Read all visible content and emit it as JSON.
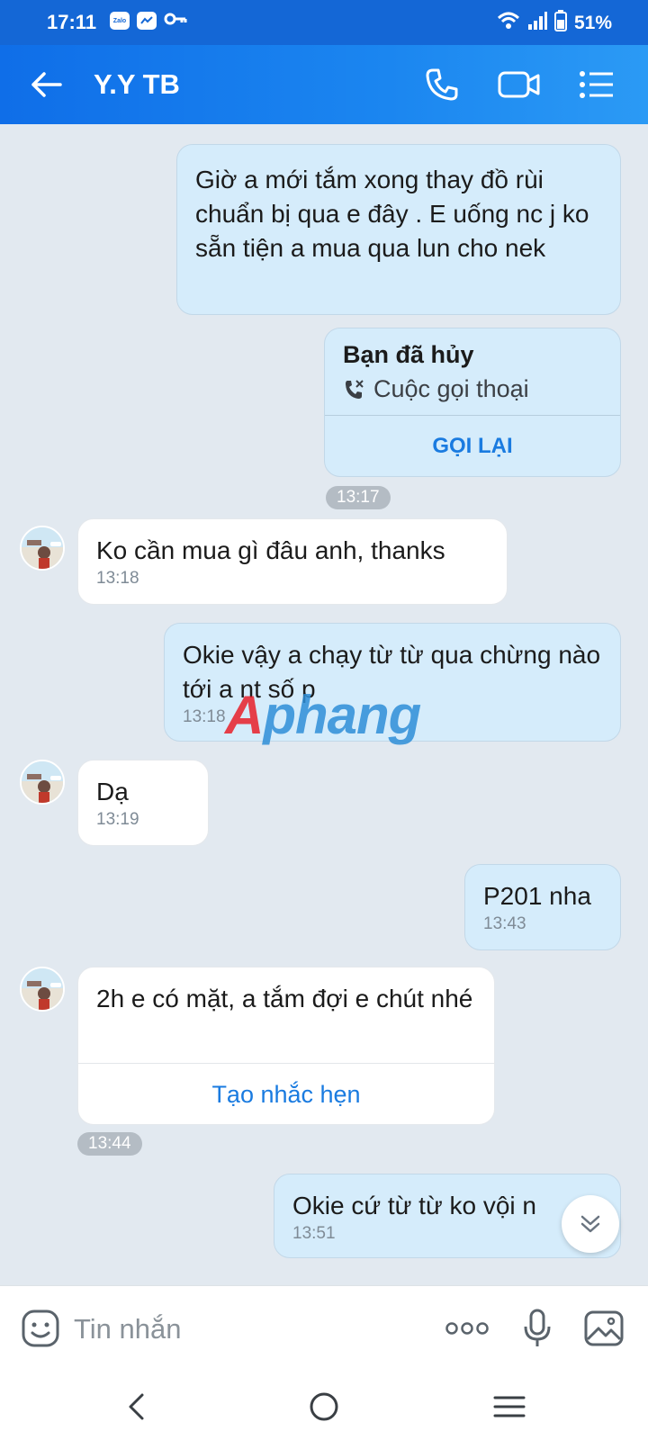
{
  "status": {
    "time": "17:11",
    "app_icon_label": "Zalo",
    "battery": "51%"
  },
  "header": {
    "title": "Y.Y TB"
  },
  "messages": [
    {
      "text": "Giờ a mới tắm xong thay đồ rùi chuẩn bị qua e đây . E uống nc j ko sẵn tiện a mua qua lun cho nek"
    },
    {
      "call_title": "Bạn đã hủy",
      "call_subtitle": "Cuộc gọi thoại",
      "call_action": "GỌI LẠI",
      "time": "13:17"
    },
    {
      "text": "Ko cần mua gì đâu anh, thanks",
      "time": "13:18"
    },
    {
      "text": "Okie vậy a chạy từ từ qua chừng nào tới a nt số p",
      "time": "13:18"
    },
    {
      "text": "Dạ",
      "time": "13:19"
    },
    {
      "text": "P201 nha",
      "time": "13:43"
    },
    {
      "text": "2h e có mặt, a tắm đợi e chút nhé",
      "action": "Tạo nhắc hẹn",
      "time": "13:44"
    },
    {
      "text": "Okie cứ từ từ ko vội n",
      "time": "13:51"
    }
  ],
  "watermark": {
    "first": "A",
    "rest": "phang"
  },
  "input": {
    "placeholder": "Tin nhắn"
  },
  "colors": {
    "header": "#1b86f0",
    "sent_bubble": "#d5ecfb",
    "received_bubble": "#ffffff",
    "chat_background": "#e2e9f0",
    "link": "#1a7be0"
  }
}
